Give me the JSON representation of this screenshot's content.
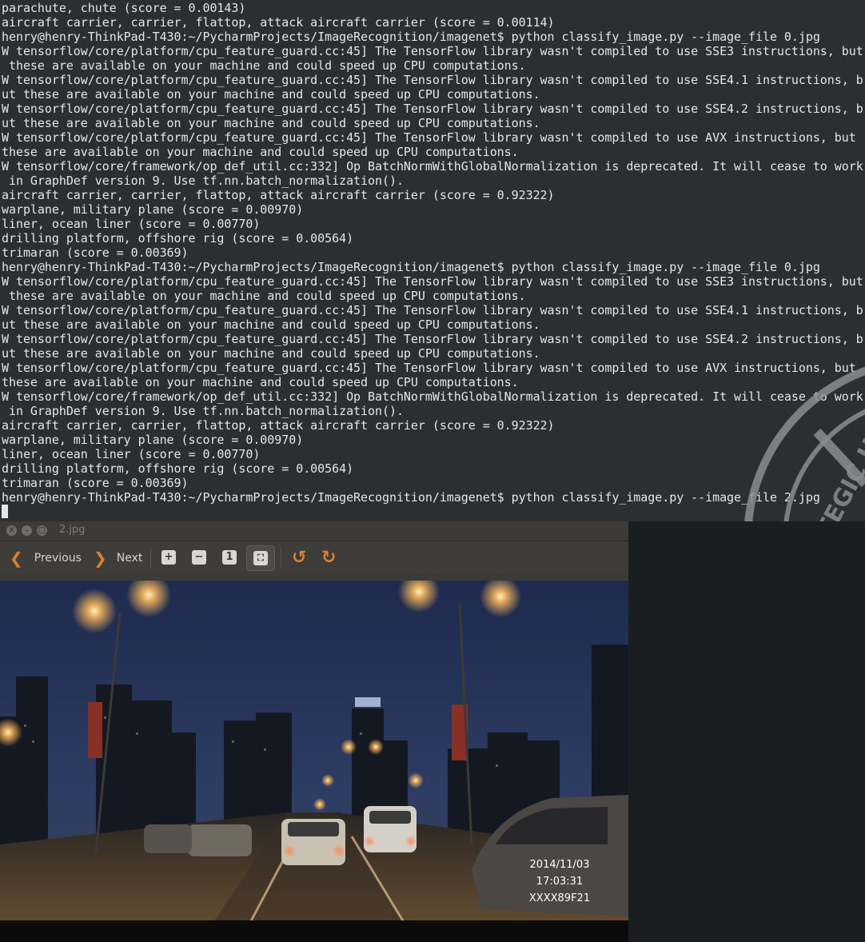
{
  "terminal": {
    "lines": [
      "parachute, chute (score = 0.00143)",
      "aircraft carrier, carrier, flattop, attack aircraft carrier (score = 0.00114)",
      "henry@henry-ThinkPad-T430:~/PycharmProjects/ImageRecognition/imagenet$ python classify_image.py --image_file 0.jpg",
      "W tensorflow/core/platform/cpu_feature_guard.cc:45] The TensorFlow library wasn't compiled to use SSE3 instructions, but",
      " these are available on your machine and could speed up CPU computations.",
      "W tensorflow/core/platform/cpu_feature_guard.cc:45] The TensorFlow library wasn't compiled to use SSE4.1 instructions, b",
      "ut these are available on your machine and could speed up CPU computations.",
      "W tensorflow/core/platform/cpu_feature_guard.cc:45] The TensorFlow library wasn't compiled to use SSE4.2 instructions, b",
      "ut these are available on your machine and could speed up CPU computations.",
      "W tensorflow/core/platform/cpu_feature_guard.cc:45] The TensorFlow library wasn't compiled to use AVX instructions, but",
      "these are available on your machine and could speed up CPU computations.",
      "W tensorflow/core/framework/op_def_util.cc:332] Op BatchNormWithGlobalNormalization is deprecated. It will cease to work",
      " in GraphDef version 9. Use tf.nn.batch_normalization().",
      "aircraft carrier, carrier, flattop, attack aircraft carrier (score = 0.92322)",
      "warplane, military plane (score = 0.00970)",
      "liner, ocean liner (score = 0.00770)",
      "drilling platform, offshore rig (score = 0.00564)",
      "trimaran (score = 0.00369)",
      "henry@henry-ThinkPad-T430:~/PycharmProjects/ImageRecognition/imagenet$ python classify_image.py --image_file 0.jpg",
      "W tensorflow/core/platform/cpu_feature_guard.cc:45] The TensorFlow library wasn't compiled to use SSE3 instructions, but",
      " these are available on your machine and could speed up CPU computations.",
      "W tensorflow/core/platform/cpu_feature_guard.cc:45] The TensorFlow library wasn't compiled to use SSE4.1 instructions, b",
      "ut these are available on your machine and could speed up CPU computations.",
      "W tensorflow/core/platform/cpu_feature_guard.cc:45] The TensorFlow library wasn't compiled to use SSE4.2 instructions, b",
      "ut these are available on your machine and could speed up CPU computations.",
      "W tensorflow/core/platform/cpu_feature_guard.cc:45] The TensorFlow library wasn't compiled to use AVX instructions, but",
      "these are available on your machine and could speed up CPU computations.",
      "W tensorflow/core/framework/op_def_util.cc:332] Op BatchNormWithGlobalNormalization is deprecated. It will cease to work",
      " in GraphDef version 9. Use tf.nn.batch_normalization().",
      "aircraft carrier, carrier, flattop, attack aircraft carrier (score = 0.92322)",
      "warplane, military plane (score = 0.00970)",
      "liner, ocean liner (score = 0.00770)",
      "drilling platform, offshore rig (score = 0.00564)",
      "trimaran (score = 0.00369)",
      "henry@henry-ThinkPad-T430:~/PycharmProjects/ImageRecognition/imagenet$ python classify_image.py --image_file 2.jpg"
    ]
  },
  "watermark": {
    "text": "STRATEGIC HOME"
  },
  "viewer": {
    "window_title": "2.jpg",
    "window_buttons": [
      "close",
      "minimize",
      "maximize"
    ],
    "toolbar": {
      "previous_label": "Previous",
      "next_label": "Next",
      "zoom_in_icon": "zoom-in-icon",
      "zoom_out_icon": "zoom-out-icon",
      "normal_size_icon": "normal-size-icon",
      "best_fit_icon": "best-fit-icon",
      "rotate_left_icon": "rotate-left-icon",
      "rotate_right_icon": "rotate-right-icon"
    },
    "photo": {
      "description_type": "night dashcam street scene",
      "timestamp_date": "2014/11/03",
      "timestamp_time": "17:03:31",
      "timestamp_id": "XXXX89F21"
    }
  },
  "colors": {
    "terminal_bg": "#2c2e30",
    "terminal_text": "#e6e6e6",
    "accent_orange": "#d9822b",
    "viewer_toolbar": "#3e3d39",
    "right_panel": "#1b1e21"
  }
}
